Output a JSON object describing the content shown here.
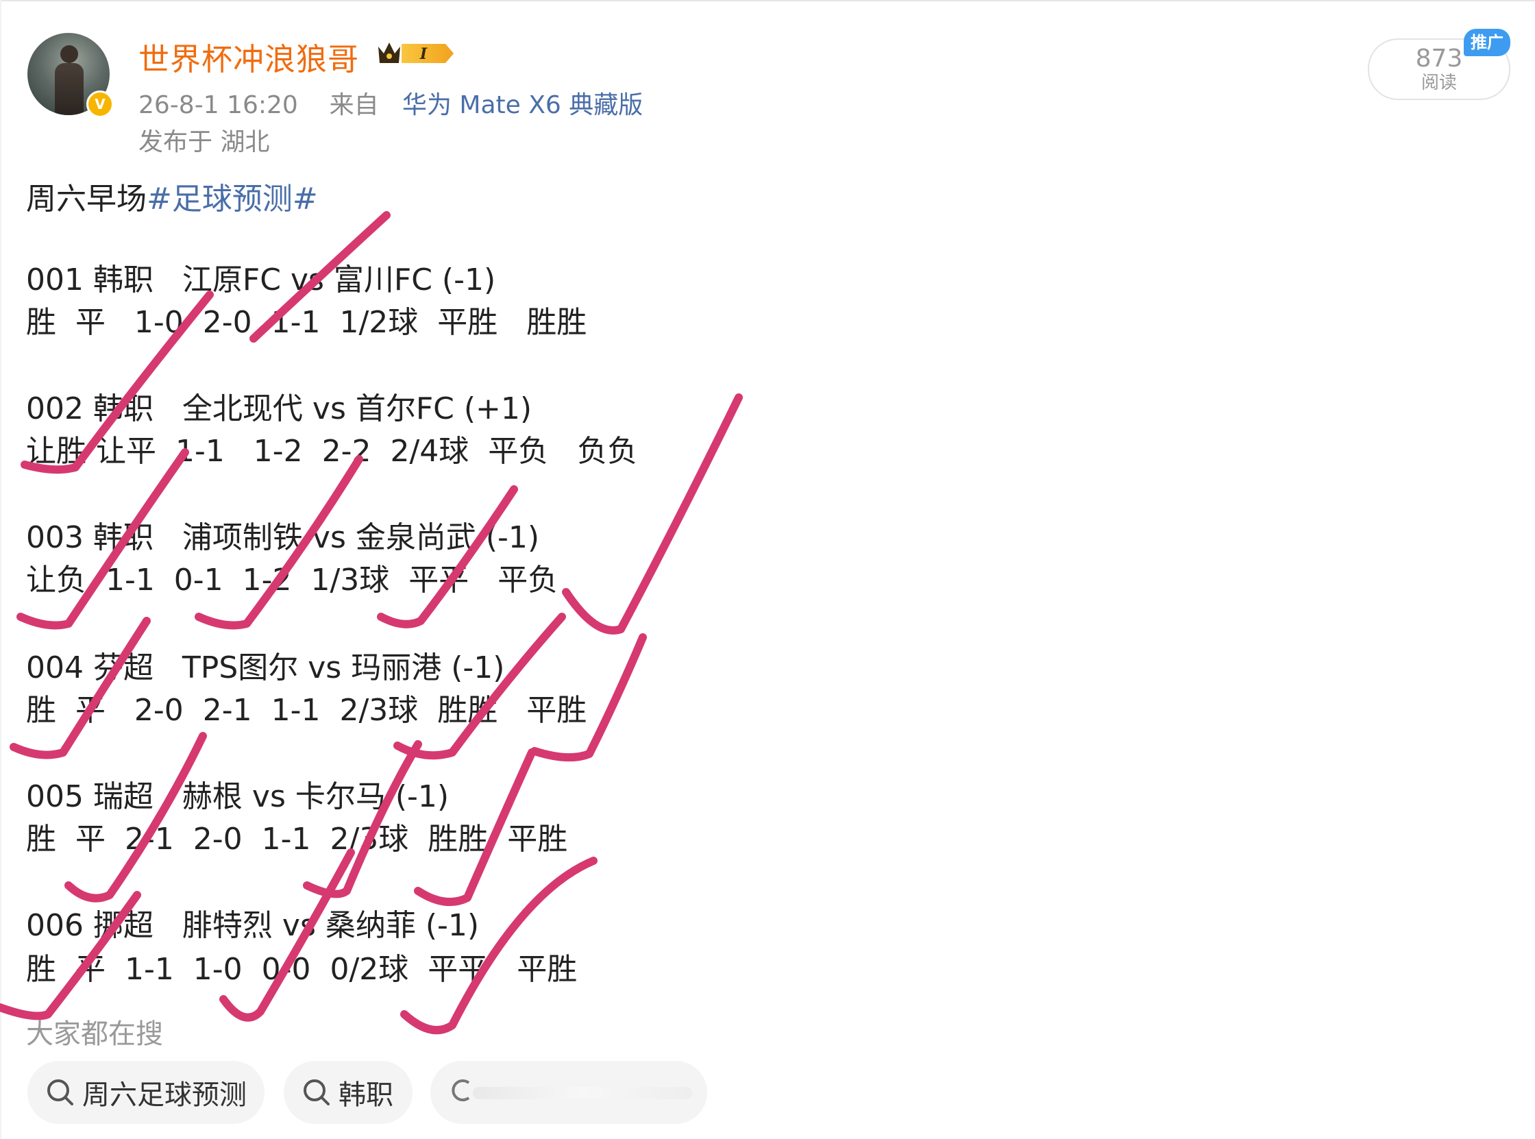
{
  "header": {
    "username": "世界杯冲浪狼哥",
    "timestamp": "26-8-1 16:20",
    "source_prefix": "来自",
    "device": "华为 Mate X6 典藏版",
    "location": "发布于 湖北",
    "verified_badge": "V",
    "crown_level": "I"
  },
  "stats": {
    "read_count": "873",
    "read_label": "阅读",
    "promo_badge": "推广"
  },
  "post": {
    "title_prefix": "周六早场",
    "hashtag": "#足球预测#",
    "matches": [
      {
        "header": "001 韩职   江原FC vs 富川FC (-1)",
        "picks": "胜  平   1-0  2-0  1-1  1/2球  平胜   胜胜"
      },
      {
        "header": "002 韩职   全北现代 vs 首尔FC (+1)",
        "picks": "让胜 让平  1-1   1-2  2-2  2/4球  平负   负负"
      },
      {
        "header": "003 韩职   浦项制铁 vs 金泉尚武 (-1)",
        "picks": "让负  1-1  0-1  1-2  1/3球  平平   平负"
      },
      {
        "header": "004 芬超   TPS图尔 vs 玛丽港 (-1)",
        "picks": "胜  平   2-0  2-1  1-1  2/3球  胜胜   平胜"
      },
      {
        "header": "005 瑞超   赫根 vs 卡尔马 (-1)",
        "picks": "胜  平  2-1  2-0  1-1  2/3球  胜胜  平胜"
      },
      {
        "header": "006 挪超   腓特烈 vs 桑纳菲 (-1)",
        "picks": "胜  平  1-1  1-0  0-0  0/2球  平平   平胜"
      }
    ]
  },
  "search": {
    "heading": "大家都在搜",
    "chips": [
      "周六足球预测",
      "韩职"
    ]
  },
  "colors": {
    "username": "#f06d0f",
    "link": "#4a6ea8",
    "tick_marks": "#d6396f",
    "promo": "#3d9bf0"
  }
}
